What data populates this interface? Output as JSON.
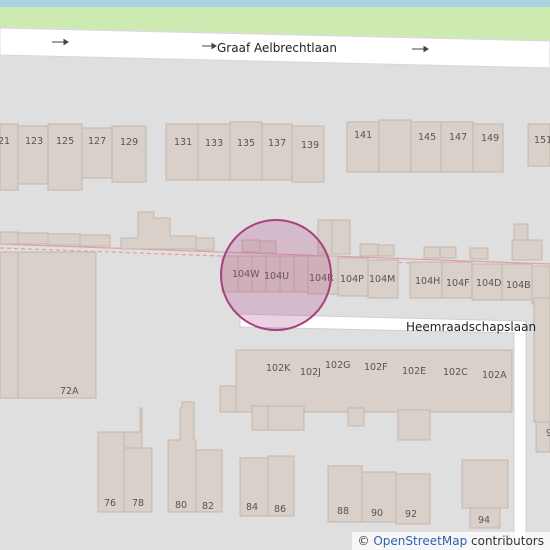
{
  "streets": {
    "top": "Graaf Aelbrechtlaan",
    "middle": "Heemraadschapslaan"
  },
  "house_numbers": {
    "row_top": [
      "21",
      "123",
      "125",
      "127",
      "129",
      "131",
      "133",
      "135",
      "137",
      "139",
      "141",
      "145",
      "147",
      "149",
      "151"
    ],
    "row_mid": [
      "104W",
      "104U",
      "104R",
      "104P",
      "104M",
      "104H",
      "104F",
      "104D",
      "104B"
    ],
    "row_lower": [
      "102K",
      "102J",
      "102G",
      "102F",
      "102E",
      "102C",
      "102A"
    ],
    "row_bottom": [
      "76",
      "78",
      "80",
      "82",
      "84",
      "86",
      "88",
      "90",
      "92",
      "94"
    ],
    "other": [
      "72A",
      "9"
    ]
  },
  "attribution": {
    "copyright": "©",
    "link": "OpenStreetMap",
    "suffix": "contributors"
  },
  "colors": {
    "background": "#e0dfdf",
    "building": "#d9d0c9",
    "building_stroke": "#c4b6ab",
    "road": "#ffffff",
    "grass": "#cdebb0",
    "water": "#aad3df",
    "railway": "#e8a0a0",
    "marker": "#b04c8f"
  }
}
